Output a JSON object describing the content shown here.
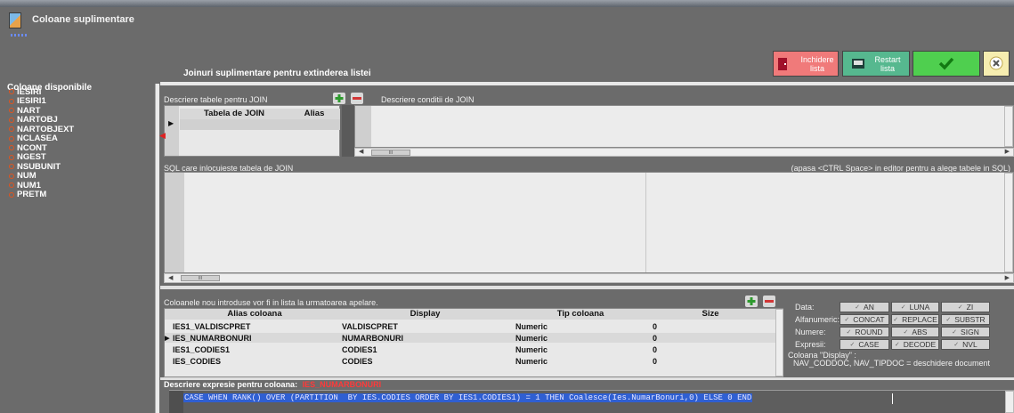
{
  "window": {
    "title": "Coloane suplimentare"
  },
  "toolbar": {
    "close": {
      "label_line1": "Inchidere",
      "label_line2": "lista",
      "color": "#f07a7a"
    },
    "restart": {
      "label_line1": "Restart",
      "label_line2": "lista",
      "color": "#56b88f"
    },
    "ok": {
      "color": "#4fcf4f"
    },
    "cancel": {
      "color": "#f6edb0"
    }
  },
  "sidebar": {
    "title": "Coloane disponibile",
    "items": [
      "IESIRI",
      "IESIRI1",
      "NART",
      "NARTOBJ",
      "NARTOBJEXT",
      "NCLASEA",
      "NCONT",
      "NGEST",
      "NSUBUNIT",
      "NUM",
      "NUM1",
      "PRETM"
    ]
  },
  "main": {
    "section_title": "Joinuri suplimentare pentru extinderea listei",
    "join": {
      "tables_label": "Descriere tabele pentru JOIN",
      "conditions_label": "Descriere conditii de JOIN",
      "columns": [
        "Tabela de JOIN",
        "Alias"
      ]
    },
    "sql": {
      "label": "SQL care inlocuieste tabela de JOIN",
      "hint": "(apasa <CTRL Space> in editor pentru a alege tabele in SQL)"
    },
    "new_cols": {
      "label": "Coloanele nou introduse vor fi in lista la urmatoarea apelare.",
      "columns": [
        "Alias coloana",
        "Display",
        "Tip coloana",
        "Size"
      ],
      "rows": [
        {
          "alias": "IES1_VALDISCPRET",
          "display": "VALDISCPRET",
          "type": "Numeric",
          "size": "0"
        },
        {
          "alias": "IES_NUMARBONURI",
          "display": "NUMARBONURI",
          "type": "Numeric",
          "size": "0"
        },
        {
          "alias": "IES1_CODIES1",
          "display": "CODIES1",
          "type": "Numeric",
          "size": "0"
        },
        {
          "alias": "IES_CODIES",
          "display": "CODIES",
          "type": "Numeric",
          "size": "0"
        }
      ]
    },
    "functions": {
      "data_label": "Data:",
      "data": [
        "AN",
        "LUNA",
        "ZI"
      ],
      "alfa_label": "Alfanumeric:",
      "alfa": [
        "CONCAT",
        "REPLACE",
        "SUBSTR"
      ],
      "num_label": "Numere:",
      "num": [
        "ROUND",
        "ABS",
        "SIGN"
      ],
      "expr_label": "Expresii:",
      "expr": [
        "CASE",
        "DECODE",
        "NVL"
      ],
      "display_note1": "Coloana \"Display\" :",
      "display_note2": "NAV_CODDOC, NAV_TIPDOC = deschidere document"
    },
    "expression": {
      "label": "Descriere expresie pentru coloana:",
      "column": "IES_NUMARBONURI",
      "code": "CASE WHEN RANK() OVER (PARTITION  BY IES.CODIES ORDER BY IES1.CODIES1) = 1 THEN Coalesce(Ies.NumarBonuri,0) ELSE 0 END"
    },
    "scroll_mark": "III"
  }
}
